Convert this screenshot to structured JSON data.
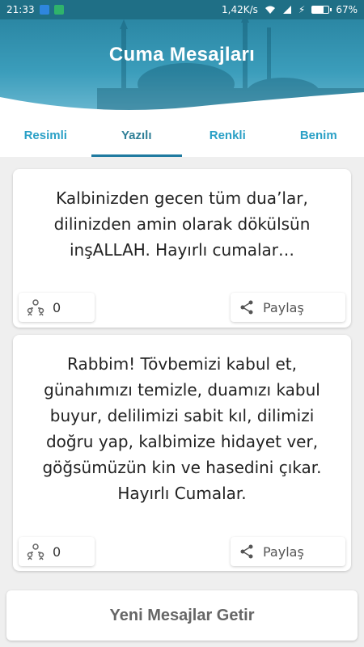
{
  "status_bar": {
    "time": "21:33",
    "network_speed": "1,42K/s",
    "battery_percent": "67%",
    "battery_level": 0.67
  },
  "header": {
    "title": "Cuma Mesajları"
  },
  "tabs": [
    {
      "label": "Resimli"
    },
    {
      "label": "Yazılı"
    },
    {
      "label": "Renkli"
    },
    {
      "label": "Benim"
    }
  ],
  "cards": [
    {
      "message": "Kalbinizden gecen tüm dua’lar, dilinizden amin olarak dökülsün inşALLAH. Hayırlı cumalar…",
      "count": "0",
      "share_label": "Paylaş"
    },
    {
      "message": "Rabbim! Tövbemizi kabul et, günahımızı temizle, duamızı kabul buyur, delilimizi sabit kıl, dilimizi doğru yap, kalbimize hidayet ver, göğsümüzün kin ve hasedini çıkar. Hayırlı Cumalar.",
      "count": "0",
      "share_label": "Paylaş"
    }
  ],
  "bottom_button": {
    "label": "Yeni Mesajlar Getir"
  },
  "colors": {
    "status_bar": "#1f6f86",
    "header": "#2b87a4",
    "tab_text": "#2aa0c6",
    "tab_indicator": "#1f7aa0"
  },
  "icons": {
    "count": "people-icon",
    "share": "share-icon"
  }
}
